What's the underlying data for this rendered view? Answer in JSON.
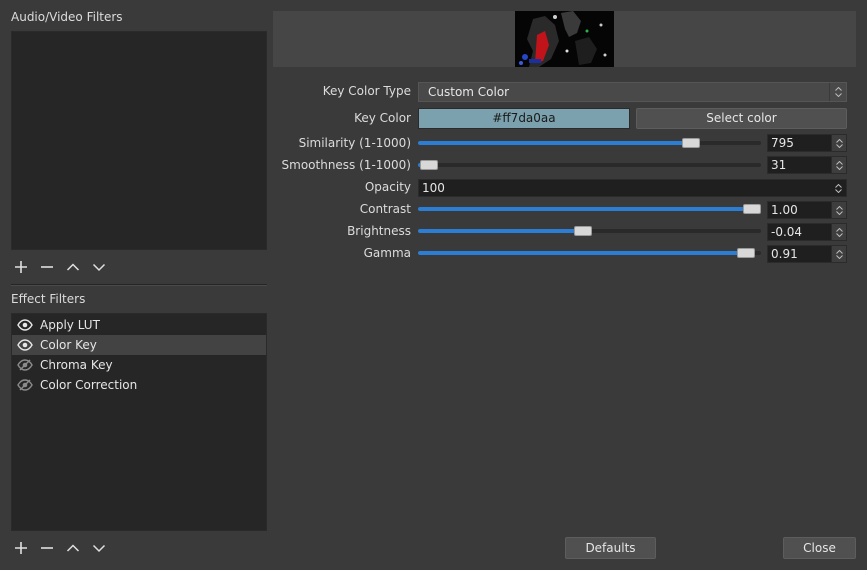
{
  "audio_video_filters": {
    "title": "Audio/Video Filters"
  },
  "effect_filters": {
    "title": "Effect Filters",
    "items": [
      {
        "label": "Apply LUT",
        "visible": true,
        "selected": false
      },
      {
        "label": "Color Key",
        "visible": true,
        "selected": true
      },
      {
        "label": "Chroma Key",
        "visible": false,
        "selected": false
      },
      {
        "label": "Color Correction",
        "visible": false,
        "selected": false
      }
    ]
  },
  "toolbar_icons": [
    "plus-icon",
    "minus-icon",
    "chevron-up-icon",
    "chevron-down-icon"
  ],
  "properties": {
    "key_color_type": {
      "label": "Key Color Type",
      "value": "Custom Color"
    },
    "key_color": {
      "label": "Key Color",
      "value": "#ff7da0aa",
      "swatch": "#7aa1ad",
      "select_label": "Select color"
    },
    "similarity": {
      "label": "Similarity (1-1000)",
      "value": "795",
      "fraction": 0.795
    },
    "smoothness": {
      "label": "Smoothness (1-1000)",
      "value": "31",
      "fraction": 0.031
    },
    "opacity": {
      "label": "Opacity",
      "value": "100"
    },
    "contrast": {
      "label": "Contrast",
      "value": "1.00",
      "fraction": 1.0
    },
    "brightness": {
      "label": "Brightness",
      "value": "-0.04",
      "fraction": 0.48
    },
    "gamma": {
      "label": "Gamma",
      "value": "0.91",
      "fraction": 0.955
    }
  },
  "footer": {
    "defaults_label": "Defaults",
    "close_label": "Close"
  },
  "colors": {
    "accent": "#2c7dd4",
    "background": "#3a3a3a",
    "panel": "#262626"
  }
}
